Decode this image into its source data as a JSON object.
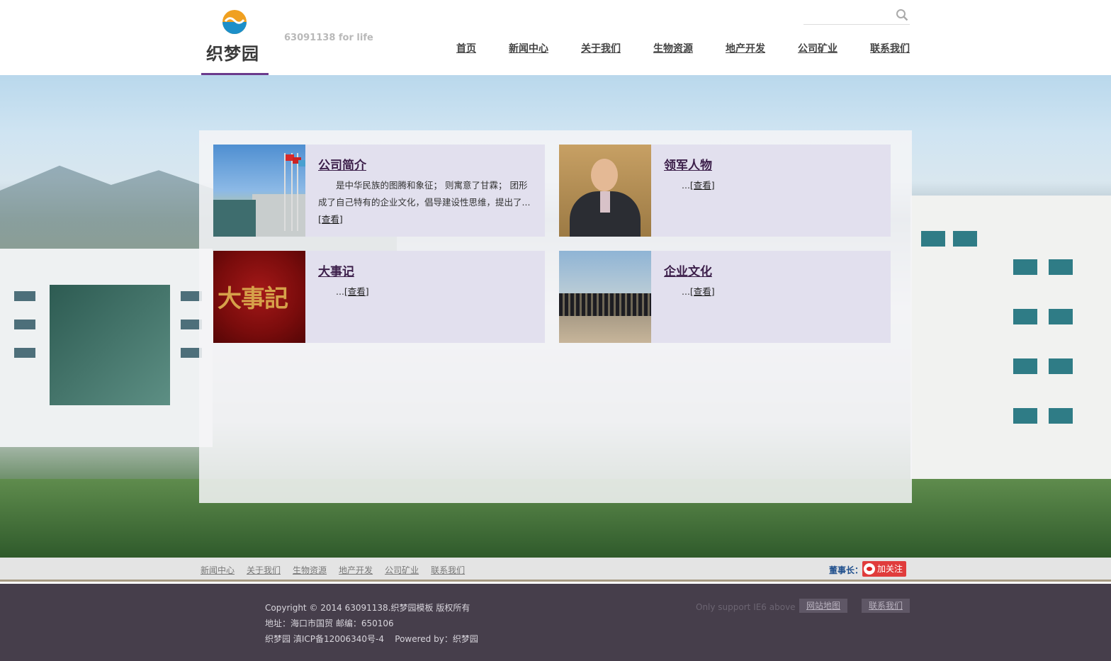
{
  "header": {
    "logo_text": "织梦园",
    "slogan": "63091138 for life",
    "search": {
      "placeholder": "",
      "value": ""
    },
    "nav": [
      "首页",
      "新闻中心",
      "关于我们",
      "生物资源",
      "地产开发",
      "公司矿业",
      "联系我们"
    ]
  },
  "cards": [
    {
      "title": "公司简介",
      "desc": "是中华民族的图腾和象征； 则寓意了甘霖； 团形成了自己特有的企业文化，倡导建设性思维，提出了...",
      "more": "[查看]"
    },
    {
      "title": "领军人物",
      "desc": "...",
      "more": "[查看]"
    },
    {
      "title": "大事记",
      "desc": "...",
      "more": "[查看]",
      "thumb_text": "大事記"
    },
    {
      "title": "企业文化",
      "desc": "...",
      "more": "[查看]"
    }
  ],
  "footer_bar": {
    "nav": [
      "新闻中心",
      "关于我们",
      "生物资源",
      "地产开发",
      "公司矿业",
      "联系我们"
    ],
    "chairman_label": "董事长：",
    "follow_label": "加关注"
  },
  "footer": {
    "lines": [
      "Copyright © 2014 63091138.织梦园模板 版权所有",
      "地址：海口市国贸 邮编：650106",
      "织梦园 滇ICP备12006340号-4    Powered by：织梦园"
    ],
    "ie_note": "Only support IE6 above",
    "sitemap_label": "网站地图",
    "contact_label": "联系我们"
  },
  "colors": {
    "accent": "#6b3a8c",
    "card_bg": "#e2e0ee",
    "footer_bg": "#463e4b",
    "follow_red": "#e03c3c"
  },
  "icons": [
    "logo-icon",
    "search-icon",
    "weibo-icon"
  ]
}
